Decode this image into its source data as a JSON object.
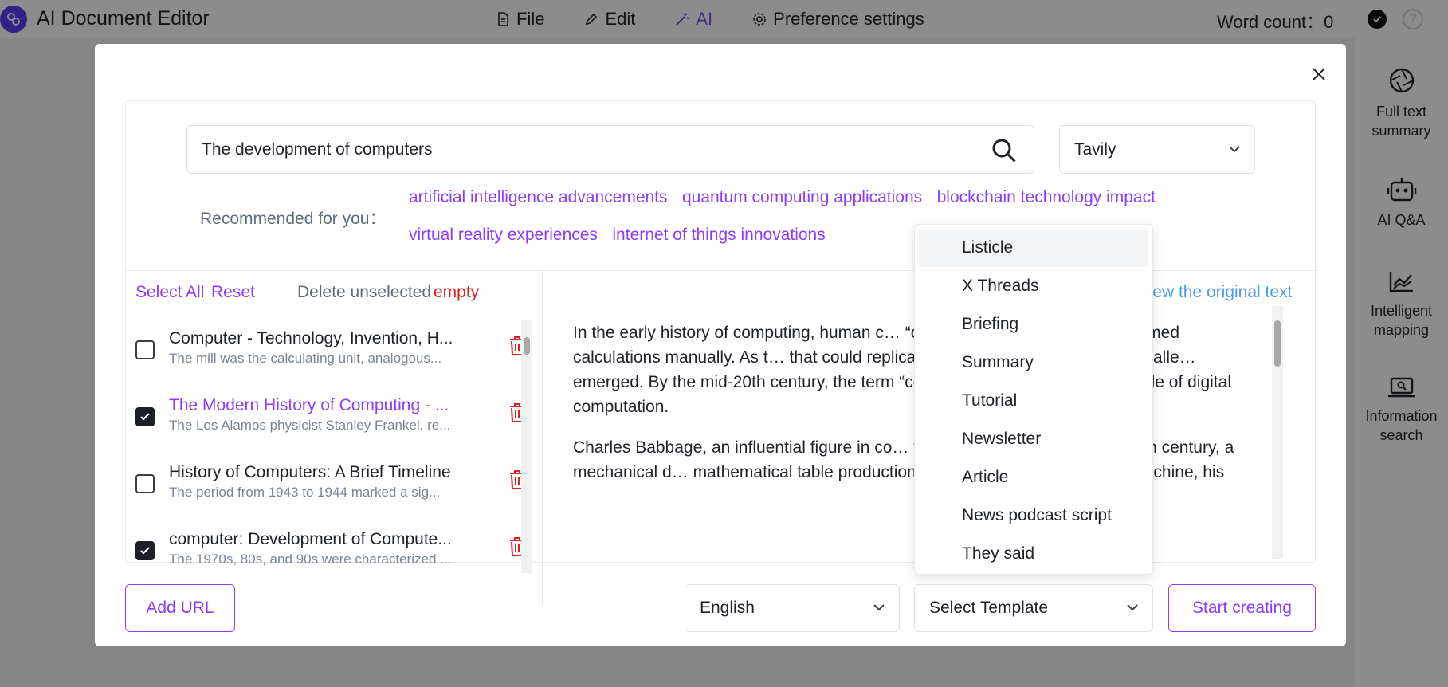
{
  "app": {
    "title": "AI Document Editor",
    "word_count_label": "Word count：",
    "word_count": "0"
  },
  "menu": [
    {
      "label": "File",
      "icon": "file-icon",
      "active": false
    },
    {
      "label": "Edit",
      "icon": "pen-icon",
      "active": false
    },
    {
      "label": "AI",
      "icon": "magic-wand-icon",
      "active": true
    },
    {
      "label": "Preference settings",
      "icon": "gear-icon",
      "active": false
    }
  ],
  "sidepanel": {
    "items": [
      {
        "label": "Full text summary",
        "icon": "aperture-icon"
      },
      {
        "label": "AI Q&A",
        "icon": "robot-icon"
      },
      {
        "label": "Intelligent mapping",
        "icon": "chart-area-icon"
      },
      {
        "label": "Information search",
        "icon": "laptop-search-icon"
      }
    ]
  },
  "search": {
    "query": "The development of computers",
    "engine": "Tavily"
  },
  "recommended": {
    "label": "Recommended for you：",
    "tags": [
      "artificial intelligence advancements",
      "quantum computing applications",
      "blockchain technology impact",
      "virtual reality experiences",
      "internet of things innovations"
    ]
  },
  "list_actions": {
    "select_all": "Select All",
    "reset": "Reset",
    "delete_unselected": "Delete unselected",
    "empty": "empty"
  },
  "results": [
    {
      "title": "Computer - Technology, Invention, H...",
      "snippet": "The mill was the calculating unit, analogous...",
      "checked": false,
      "highlight": false
    },
    {
      "title": "The Modern History of Computing - ...",
      "snippet": "The Los Alamos physicist Stanley Frankel, re...",
      "checked": true,
      "highlight": true
    },
    {
      "title": "History of Computers: A Brief Timeline",
      "snippet": "The period from 1943 to 1944 marked a sig...",
      "checked": false,
      "highlight": false
    },
    {
      "title": "computer: Development of Compute...",
      "snippet": "The 1970s, 80s, and 90s were characterized ...",
      "checked": true,
      "highlight": false
    }
  ],
  "article": {
    "view_original": "View the original text",
    "paragraphs": [
      "In the early history of computing, human c… “computers” because they performed calculations manually. As t… that could replicate these human computations, calle… emerged. By the mid-20th century, the term “computer” car… machines capable of digital computation.",
      "Charles Babbage, an influential figure in co… the Difference Engine in the 19th century, a mechanical d… mathematical table production. Although Babbage never… machine, his"
    ]
  },
  "bottom": {
    "add_url": "Add URL",
    "language": "English",
    "template_placeholder": "Select Template",
    "start": "Start creating"
  },
  "template_options": [
    "Listicle",
    "X Threads",
    "Briefing",
    "Summary",
    "Tutorial",
    "Newsletter",
    "Article",
    "News podcast script",
    "They said"
  ],
  "colors": {
    "accent": "#8b3dff",
    "danger": "#e02020",
    "link": "#4a9cf0"
  }
}
